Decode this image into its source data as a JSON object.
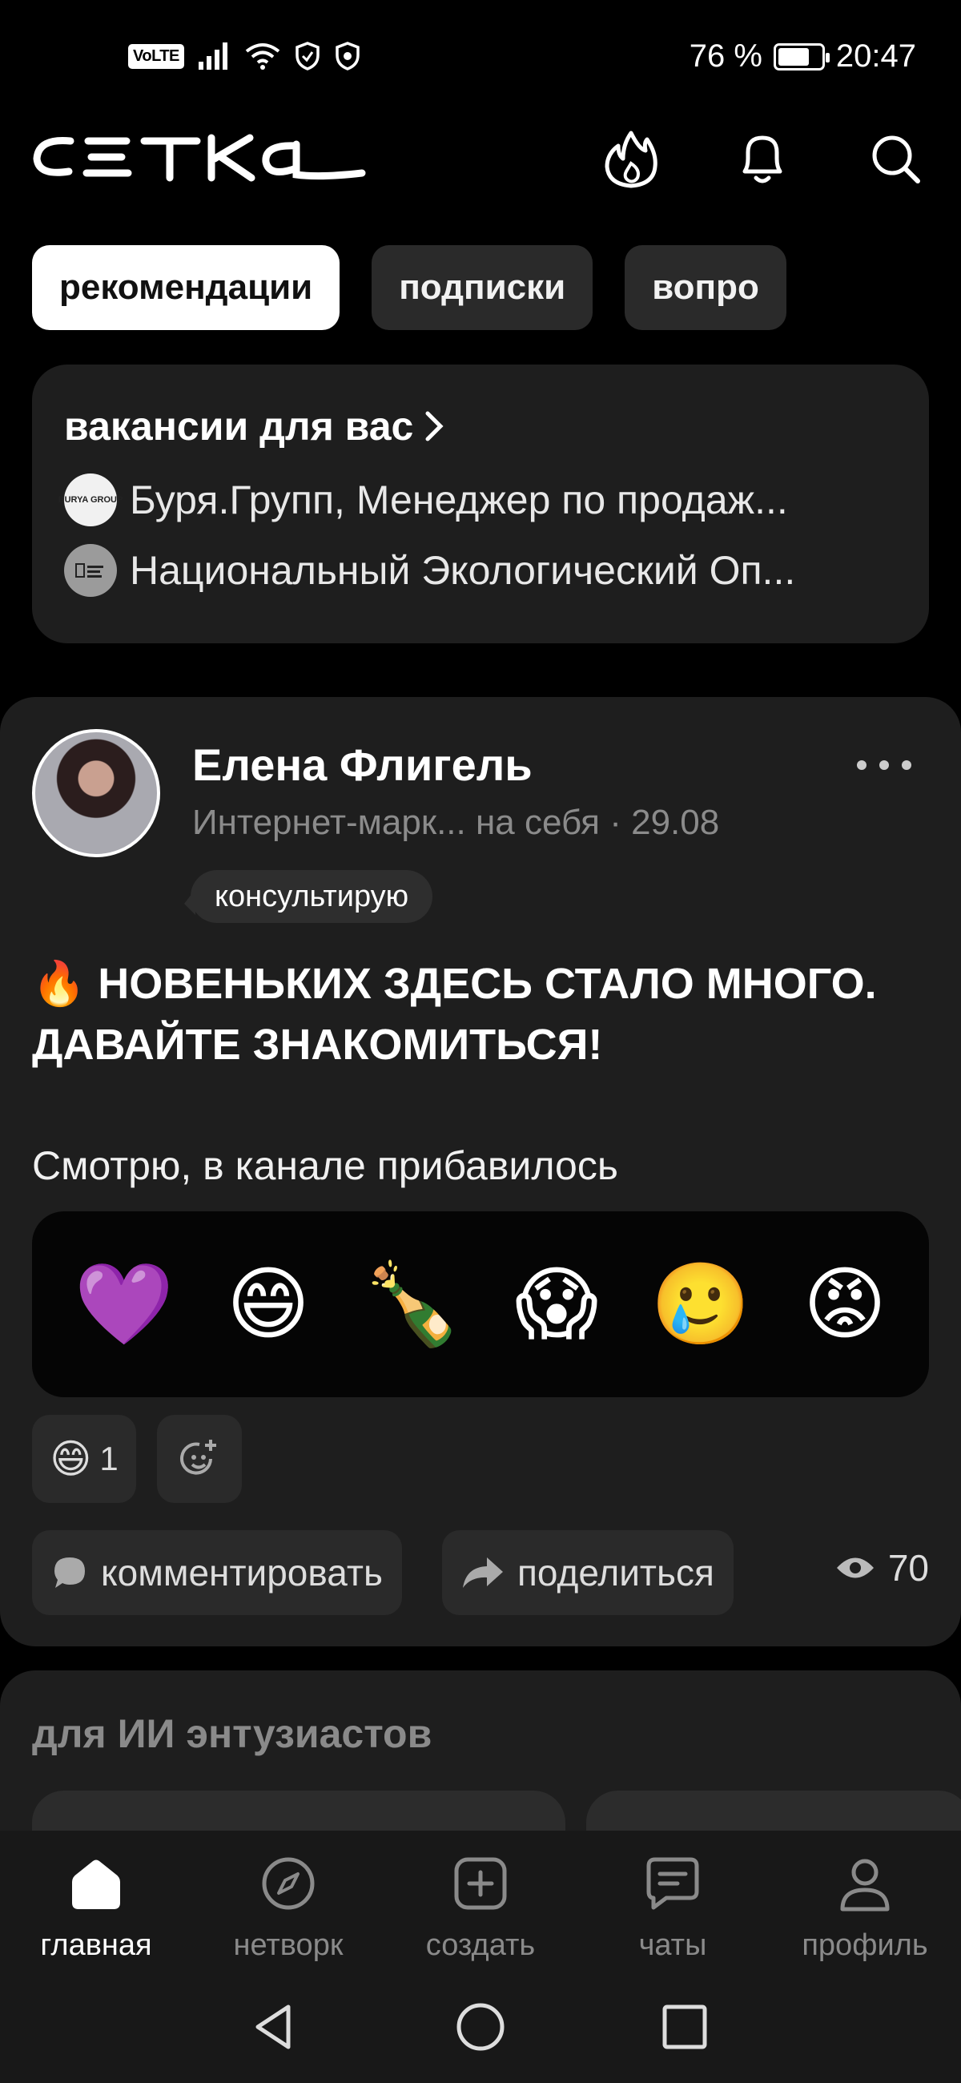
{
  "status_bar": {
    "network_badge": "VoLTE",
    "battery_percent": "76 %",
    "battery_level": 0.76,
    "time": "20:47"
  },
  "header": {
    "logo_text": "СЕТКА",
    "icons": [
      "fire-icon",
      "bell-icon",
      "search-icon"
    ]
  },
  "tabs": [
    {
      "label": "рекомендации",
      "active": true
    },
    {
      "label": "подписки",
      "active": false
    },
    {
      "label": "вопро",
      "active": false
    }
  ],
  "vacancies": {
    "title": "вакансии для вас",
    "items": [
      {
        "logo_text": "BURYA GROUP",
        "text": "Буря.Групп, Менеджер по продаж..."
      },
      {
        "logo_text": "",
        "text": "Национальный Экологический Оп..."
      }
    ]
  },
  "post": {
    "author": "Елена Флигель",
    "meta": "Интернет-марк... на себя · 29.08",
    "status_bubble": "консультирую",
    "title": "🔥 НОВЕНЬКИХ ЗДЕСЬ СТАЛО МНОГО. ДАВАЙТЕ ЗНАКОМИТЬСЯ!",
    "text_preview": "Смотрю, в канале прибавилось",
    "reaction_picker": [
      "💜",
      "😄",
      "🍾",
      "😱",
      "🥲",
      "😡"
    ],
    "reaction_count": {
      "emoji": "😄",
      "count": "1"
    },
    "comment_label": "комментировать",
    "share_label": "поделиться",
    "views": "70"
  },
  "recommendation_section": {
    "title": "для ИИ энтузиастов"
  },
  "bottom_nav": [
    {
      "label": "главная",
      "icon": "home-icon",
      "active": true
    },
    {
      "label": "нетворк",
      "icon": "compass-icon",
      "active": false
    },
    {
      "label": "создать",
      "icon": "plus-square-icon",
      "active": false
    },
    {
      "label": "чаты",
      "icon": "chat-icon",
      "active": false
    },
    {
      "label": "профиль",
      "icon": "person-icon",
      "active": false
    }
  ],
  "colors": {
    "background": "#000000",
    "card": "#1e1e1e",
    "chip": "#2a2a2a",
    "muted_text": "#8b8b8b",
    "accent_tab": "#ffffff"
  }
}
